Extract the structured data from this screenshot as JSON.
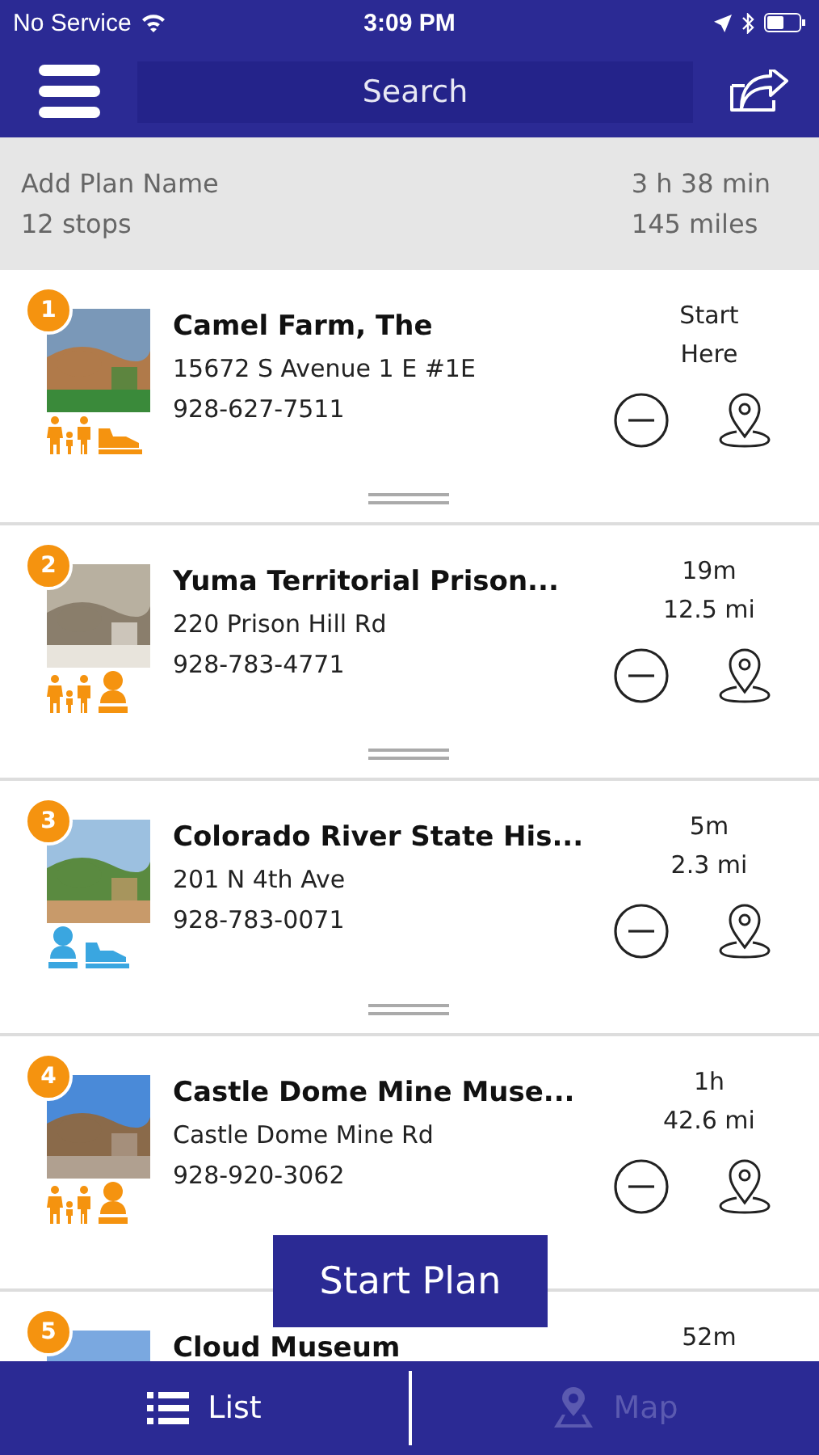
{
  "status_bar": {
    "carrier": "No Service",
    "time": "3:09 PM"
  },
  "search": {
    "placeholder": "Search"
  },
  "plan": {
    "name_placeholder": "Add Plan Name",
    "stops": "12 stops",
    "duration": "3 h 38 min",
    "distance": "145 miles"
  },
  "stops": [
    {
      "number": "1",
      "name": "Camel Farm, The",
      "address": "15672 S Avenue 1 E #1E",
      "phone": "928-627-7511",
      "time": "Start",
      "distance": "Here",
      "amenities": [
        {
          "kind": "family",
          "color": "#f5930f"
        },
        {
          "kind": "shoe",
          "color": "#f5930f"
        }
      ]
    },
    {
      "number": "2",
      "name": "Yuma Territorial Prison...",
      "address": "220 Prison Hill Rd",
      "phone": "928-783-4771",
      "time": "19m",
      "distance": "12.5 mi",
      "amenities": [
        {
          "kind": "family",
          "color": "#f5930f"
        },
        {
          "kind": "bust",
          "color": "#f5930f"
        }
      ]
    },
    {
      "number": "3",
      "name": "Colorado River State His...",
      "address": "201 N 4th Ave",
      "phone": "928-783-0071",
      "time": "5m",
      "distance": "2.3 mi",
      "amenities": [
        {
          "kind": "bust",
          "color": "#3aa6e0"
        },
        {
          "kind": "shoe",
          "color": "#3aa6e0"
        }
      ]
    },
    {
      "number": "4",
      "name": "Castle Dome Mine Muse...",
      "address": "Castle Dome Mine Rd",
      "phone": "928-920-3062",
      "time": "1h",
      "distance": "42.6 mi",
      "amenities": [
        {
          "kind": "family",
          "color": "#f5930f"
        },
        {
          "kind": "bust",
          "color": "#f5930f"
        }
      ]
    },
    {
      "number": "5",
      "name": "Cloud Museum",
      "time": "52m"
    }
  ],
  "start_button": "Start Plan",
  "tabs": [
    {
      "label": "List",
      "selected": true
    },
    {
      "label": "Map",
      "selected": false
    }
  ]
}
